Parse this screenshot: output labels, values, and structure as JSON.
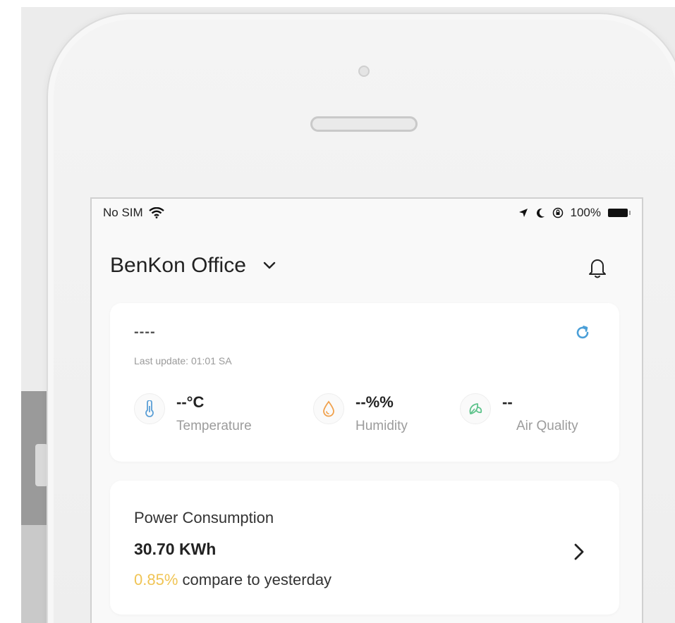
{
  "status_bar": {
    "carrier": "No SIM",
    "battery": "100%",
    "icons": [
      "wifi-icon",
      "location-arrow-icon",
      "moon-icon",
      "orientation-lock-icon",
      "battery-icon"
    ]
  },
  "header": {
    "title": "BenKon Office",
    "icons": [
      "chevron-down-icon",
      "bell-icon"
    ]
  },
  "weather_card": {
    "device_name": "----",
    "last_update": "Last update: 01:01 SA",
    "metrics": [
      {
        "value": "--°C",
        "label": "Temperature",
        "icon": "thermometer-icon",
        "color": "#5b9fd6"
      },
      {
        "value": "--%%",
        "label": "Humidity",
        "icon": "droplet-icon",
        "color": "#f0a04b"
      },
      {
        "value": "--",
        "label": "Air Quality",
        "icon": "leaf-icon",
        "color": "#5cc28a"
      }
    ],
    "refresh_icon": "refresh-icon"
  },
  "power_card": {
    "title": "Power Consumption",
    "value": "30.70 KWh",
    "change_percent": "0.85%",
    "change_text": " compare to yesterday",
    "icon": "chevron-right-icon"
  },
  "colors": {
    "accent_blue": "#4a9fd8",
    "percent_yellow": "#f0c454",
    "text_dark": "#222222",
    "text_muted": "#9a9a9a"
  }
}
